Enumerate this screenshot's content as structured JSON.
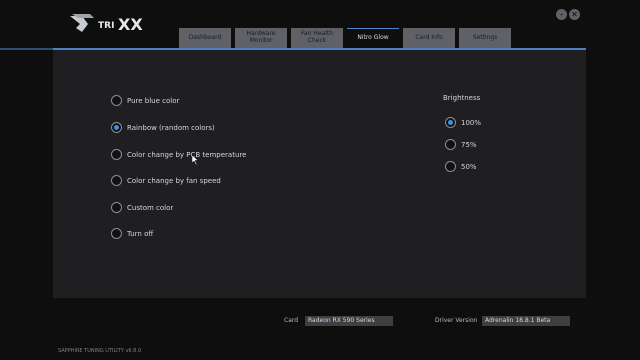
{
  "logo": {
    "text": "TRIXX"
  },
  "window": {
    "minimize_icon": "minus-icon",
    "close_icon": "close-icon"
  },
  "tabs": [
    {
      "label": "Dashboard",
      "active": false
    },
    {
      "label": "Hardware Monitor",
      "active": false
    },
    {
      "label": "Fan Health Check",
      "active": false
    },
    {
      "label": "Nitro Glow",
      "active": true
    },
    {
      "label": "Card Info",
      "active": false
    },
    {
      "label": "Settings",
      "active": false
    }
  ],
  "glow_options": [
    {
      "label": "Pure blue color",
      "checked": false
    },
    {
      "label": "Rainbow (random colors)",
      "checked": true
    },
    {
      "label": "Color change by PCB temperature",
      "checked": false
    },
    {
      "label": "Color change by fan speed",
      "checked": false
    },
    {
      "label": "Custom color",
      "checked": false
    },
    {
      "label": "Turn off",
      "checked": false
    }
  ],
  "brightness": {
    "title": "Brightness",
    "options": [
      {
        "label": "100%",
        "checked": true
      },
      {
        "label": "75%",
        "checked": false
      },
      {
        "label": "50%",
        "checked": false
      }
    ]
  },
  "footer": {
    "card_label": "Card",
    "card_value": "Radeon RX 590 Series",
    "driver_label": "Driver Version",
    "driver_value": "Adrenalin 18.8.1 Beta",
    "version_text": "SAPPHIRE TUNING UTILITY v6.8.0"
  },
  "colors": {
    "accent": "#4a82c4",
    "radio_selected": "#3f8fe8",
    "panel": "#1f1f21"
  }
}
